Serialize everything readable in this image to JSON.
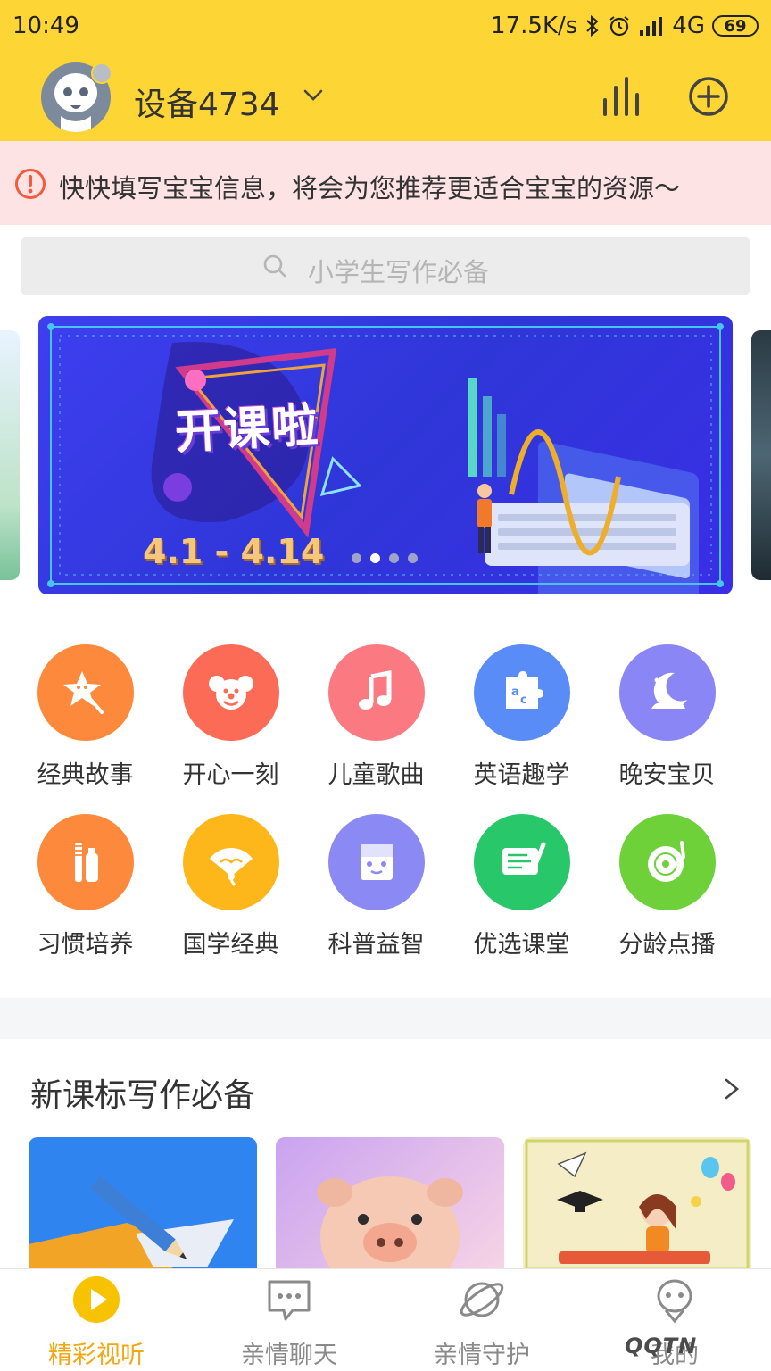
{
  "status_bar": {
    "time": "10:49",
    "network_speed": "17.5K/s",
    "network_type": "4G",
    "battery": "69"
  },
  "header": {
    "device_name": "设备4734"
  },
  "notice": {
    "text": "快快填写宝宝信息，将会为您推荐更适合宝宝的资源～"
  },
  "search": {
    "placeholder": "小学生写作必备"
  },
  "banner": {
    "title": "开课啦",
    "date_range": "4.1 - 4.14",
    "slide_count": 4,
    "active_slide": 2
  },
  "categories": [
    {
      "label": "经典故事",
      "icon": "star-wand-icon",
      "color": "#fd8a3c"
    },
    {
      "label": "开心一刻",
      "icon": "clown-icon",
      "color": "#fc6b55"
    },
    {
      "label": "儿童歌曲",
      "icon": "music-note-icon",
      "color": "#fb7a82"
    },
    {
      "label": "英语趣学",
      "icon": "puzzle-icon",
      "color": "#5a8cf7"
    },
    {
      "label": "晚安宝贝",
      "icon": "moon-icon",
      "color": "#8a86f6"
    },
    {
      "label": "习惯培养",
      "icon": "toothbrush-icon",
      "color": "#fd8a3c"
    },
    {
      "label": "国学经典",
      "icon": "fan-icon",
      "color": "#fdb71b"
    },
    {
      "label": "科普益智",
      "icon": "beaker-icon",
      "color": "#8b8af5"
    },
    {
      "label": "优选课堂",
      "icon": "certificate-icon",
      "color": "#28c76a"
    },
    {
      "label": "分龄点播",
      "icon": "record-icon",
      "color": "#6fd13a"
    }
  ],
  "section": {
    "title": "新课标写作必备"
  },
  "bottom_nav": [
    {
      "label": "精彩视听",
      "icon": "play-icon",
      "active": true
    },
    {
      "label": "亲情聊天",
      "icon": "chat-icon",
      "active": false
    },
    {
      "label": "亲情守护",
      "icon": "planet-icon",
      "active": false
    },
    {
      "label": "我的",
      "icon": "profile-icon",
      "active": false
    }
  ],
  "watermark": "QQTN"
}
